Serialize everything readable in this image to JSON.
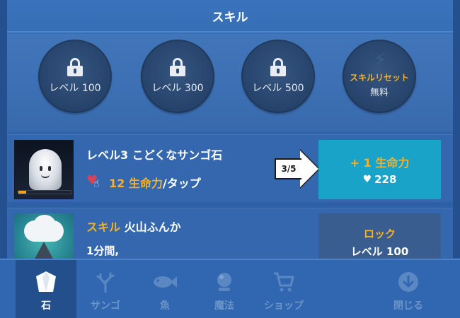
{
  "header": {
    "title": "スキル"
  },
  "skill_slots": [
    {
      "label": "レベル 100",
      "locked": true
    },
    {
      "label": "レベル 300",
      "locked": true
    },
    {
      "label": "レベル 500",
      "locked": true
    },
    {
      "label": "スキルリセット",
      "sublabel": "無料",
      "locked": false
    }
  ],
  "stone_card": {
    "title_prefix": "レベル3",
    "title_name": "こどくなサンゴ石",
    "gain_value": "12 生命力",
    "gain_suffix": "/タップ",
    "progress_fraction": 0.15,
    "tutorial_step": "3/5",
    "levelup_main": "+ 1 生命力",
    "levelup_cost": "228"
  },
  "skill_card": {
    "label_prefix": "スキル",
    "skill_name": "火山ふんか",
    "duration": "1分間,",
    "button_title": "ロック",
    "button_requirement": "レベル 100"
  },
  "tabs": [
    {
      "label": "石",
      "icon": "stone-icon",
      "active": true
    },
    {
      "label": "サンゴ",
      "icon": "coral-icon",
      "active": false
    },
    {
      "label": "魚",
      "icon": "fish-icon",
      "active": false
    },
    {
      "label": "魔法",
      "icon": "crystal-ball-icon",
      "active": false
    },
    {
      "label": "ショップ",
      "icon": "cart-icon",
      "active": false
    },
    {
      "label": "閉じる",
      "icon": "close-down-icon",
      "active": false
    }
  ],
  "colors": {
    "accent_gold": "#f2b12f",
    "levelup_button": "#1aa3c9",
    "background": "#2f62a8"
  }
}
